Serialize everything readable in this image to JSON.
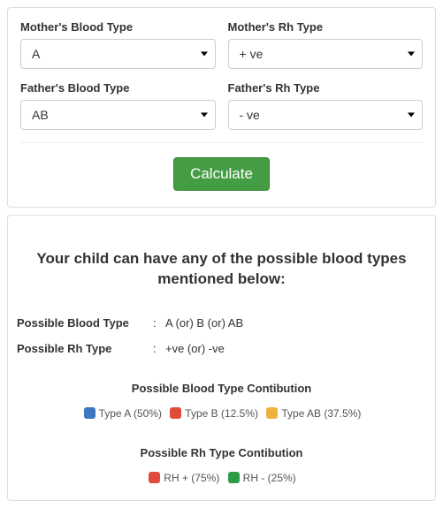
{
  "form": {
    "mother_blood_label": "Mother's Blood Type",
    "mother_blood_value": "A",
    "mother_rh_label": "Mother's Rh Type",
    "mother_rh_value": "+ ve",
    "father_blood_label": "Father's Blood Type",
    "father_blood_value": "AB",
    "father_rh_label": "Father's Rh Type",
    "father_rh_value": "- ve",
    "calculate_label": "Calculate"
  },
  "results": {
    "heading": "Your child can have any of the possible blood types mentioned below:",
    "possible_blood_key": "Possible Blood Type",
    "possible_blood_val": "A (or) B (or) AB",
    "possible_rh_key": "Possible Rh Type",
    "possible_rh_val": "+ve (or) -ve",
    "blood_contrib_title": "Possible Blood Type Contibution",
    "rh_contrib_title": "Possible Rh Type Contibution",
    "blood_legend": {
      "a": "Type A (50%)",
      "b": "Type B (12.5%)",
      "ab": "Type AB (37.5%)"
    },
    "rh_legend": {
      "pos": "RH + (75%)",
      "neg": "RH - (25%)"
    }
  },
  "chart_data": [
    {
      "type": "pie",
      "title": "Possible Blood Type Contibution",
      "categories": [
        "Type A",
        "Type B",
        "Type AB"
      ],
      "values": [
        50,
        12.5,
        37.5
      ],
      "colors": [
        "#3e76c2",
        "#e04b3e",
        "#f0b23e"
      ]
    },
    {
      "type": "pie",
      "title": "Possible Rh Type Contibution",
      "categories": [
        "RH +",
        "RH -"
      ],
      "values": [
        75,
        25
      ],
      "colors": [
        "#e04b3e",
        "#2e9c46"
      ]
    }
  ]
}
